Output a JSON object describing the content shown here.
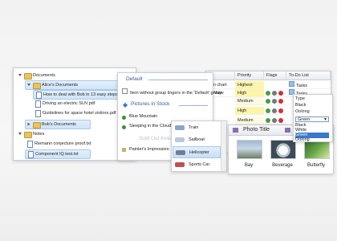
{
  "tree": {
    "items": [
      {
        "label": "Documents",
        "kind": "folder",
        "level": 0
      },
      {
        "label": "Alice's Documents",
        "kind": "folder",
        "level": 1
      },
      {
        "label": "How to deal with Bob in 13 easy steps.pdf",
        "kind": "file",
        "level": 2
      },
      {
        "label": "Driving an electric SUV.pdf",
        "kind": "file",
        "level": 2
      },
      {
        "label": "Guidelines for space hotel visitors.pdf",
        "kind": "file",
        "level": 2
      },
      {
        "label": "Bob's Documents",
        "kind": "folder",
        "level": 1
      },
      {
        "label": "Notes",
        "kind": "folder",
        "level": 0
      },
      {
        "label": "Riemann conjecture proof.txt",
        "kind": "file",
        "level": 1
      },
      {
        "label": "Component IQ test.txt",
        "kind": "file",
        "level": 1
      }
    ]
  },
  "grid": {
    "columns": [
      "Priority",
      "Flags",
      "To-Do List"
    ],
    "rows": [
      {
        "left": "son chart",
        "priority": "Highest",
        "todo": "Tasks"
      },
      {
        "left": "listView",
        "priority": "High",
        "todo": "Tasks"
      },
      {
        "left": "",
        "priority": "Medium",
        "todo": ""
      },
      {
        "left": "",
        "priority": "High",
        "todo": ""
      },
      {
        "left": "",
        "priority": "Medium",
        "todo": ""
      }
    ]
  },
  "groups": {
    "default_title": "Default",
    "default_item": "Item without group lingers in the 'Default' group",
    "stock_title": "Pictures in Stock",
    "stock_items": [
      "Blue Mountain",
      "Sleeping in the Clouds"
    ],
    "sold_title": "Sold Out Invent",
    "sold_items": [
      "Painter's Impression"
    ]
  },
  "transport": {
    "items": [
      "Train",
      "Sailboat",
      "Helicopter",
      "Sports Car"
    ],
    "selected": "Helicopter"
  },
  "photo": {
    "header": "Photo Title",
    "items": [
      "Bay",
      "Beverage",
      "Butterfly"
    ]
  },
  "dropdown": {
    "top_options": [
      "Type",
      "Black",
      "Oolong"
    ],
    "selected": "Green",
    "options": [
      "Black",
      "White",
      "Green",
      "Oolong"
    ]
  }
}
